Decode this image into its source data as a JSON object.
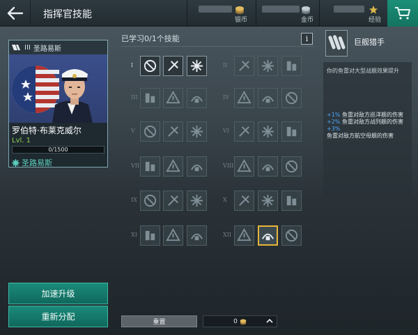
{
  "header": {
    "title": "指挥官技能",
    "resources": [
      {
        "label": "银币",
        "icon": "silver-coin-icon"
      },
      {
        "label": "金币",
        "icon": "gold-coin-icon"
      },
      {
        "label": "经验",
        "icon": "star-xp-icon"
      }
    ],
    "cart_icon": "cart-icon"
  },
  "captain": {
    "nation_tier": "III",
    "ship_header": "圣路易斯",
    "name": "罗伯特·布莱克威尔",
    "level": "Lvl. 1",
    "xp": "0/1500",
    "xp_progress": 0,
    "ship": "圣路易斯"
  },
  "left_buttons": {
    "accelerate": "加速升级",
    "redistribute": "重新分配"
  },
  "tree": {
    "learned_label": "已学习0/1个技能",
    "info_label": "i",
    "tiers_left": [
      "I",
      "III",
      "V",
      "VII",
      "IX",
      "XI"
    ],
    "tiers_right": [
      "II",
      "IV",
      "VI",
      "VIII",
      "X",
      "XII"
    ],
    "reset_label": "重置",
    "cost_value": "0"
  },
  "detail": {
    "title": "巨舰猎手",
    "description": "你的鱼雷对大型战舰效果提升",
    "bonuses": [
      {
        "value": "+1%",
        "text": "鱼雷对敌方巡洋舰的伤害"
      },
      {
        "value": "+2%",
        "text": "鱼雷对敌方战列舰的伤害"
      },
      {
        "value": "+3%",
        "text": ""
      },
      {
        "value": "",
        "text": "鱼雷对敌方航空母舰的伤害"
      }
    ]
  },
  "colors": {
    "accent_teal": "#1a8a7a",
    "selected_gold": "#e7b53b",
    "level_green": "#8fd14f",
    "bonus_blue": "#52a9ff"
  }
}
